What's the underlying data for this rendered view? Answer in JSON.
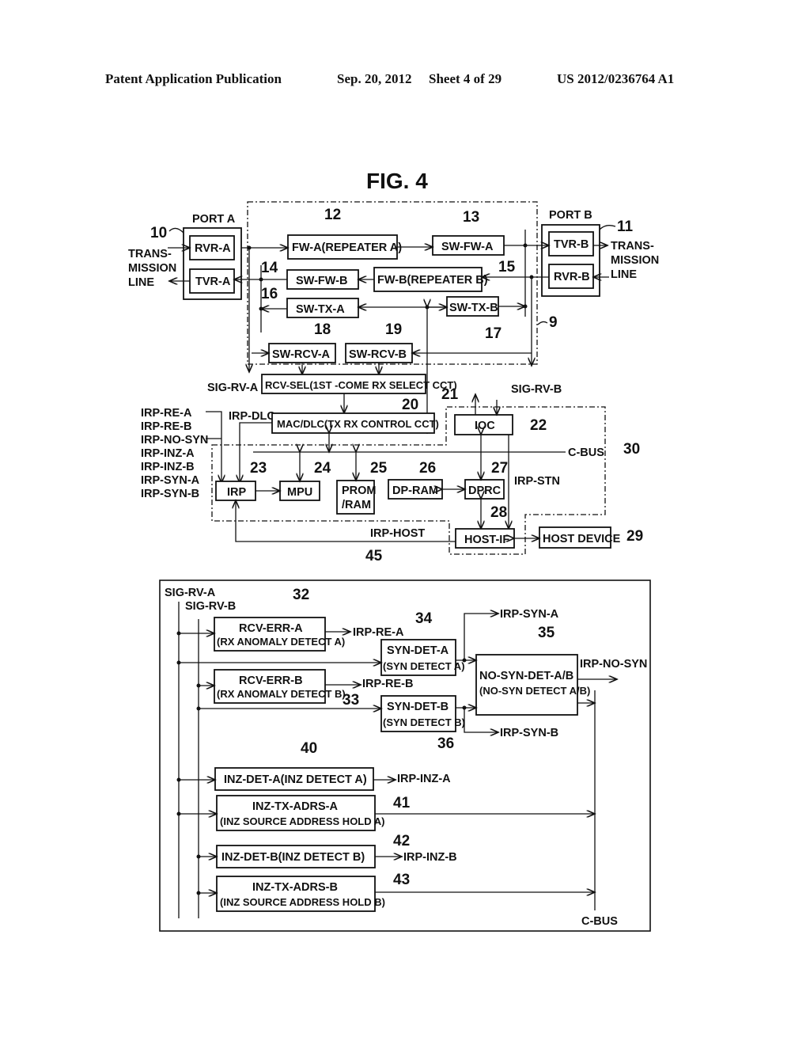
{
  "header": {
    "publication": "Patent Application Publication",
    "date": "Sep. 20, 2012",
    "sheet": "Sheet 4 of 29",
    "number": "US 2012/0236764 A1"
  },
  "figure": {
    "title": "FIG. 4",
    "port_a": {
      "label": "PORT A",
      "ref": "10",
      "rvr": "RVR-A",
      "tvr": "TVR-A"
    },
    "port_b": {
      "label": "PORT B",
      "ref": "11",
      "tvr": "TVR-B",
      "rvr": "RVR-B"
    },
    "line_left": [
      "TRANS-",
      "MISSION",
      "LINE"
    ],
    "line_right": [
      "TRANS-",
      "MISSION",
      "LINE"
    ],
    "blocks": {
      "fw_a": {
        "label": "FW-A(REPEATER A)",
        "ref": "12"
      },
      "sw_fw_a": {
        "label": "SW-FW-A",
        "ref": "13"
      },
      "sw_fw_b": {
        "label": "SW-FW-B",
        "ref": "14"
      },
      "fw_b": {
        "label": "FW-B(REPEATER B)",
        "ref": "15"
      },
      "sw_tx_a": {
        "label": "SW-TX-A",
        "ref": "16"
      },
      "sw_tx_b": {
        "label": "SW-TX-B",
        "ref": "17"
      },
      "sw_rcv_a": {
        "label": "SW-RCV-A",
        "ref": "18"
      },
      "sw_rcv_b": {
        "label": "SW-RCV-B",
        "ref": "19"
      },
      "rcv_sel": {
        "label": "RCV-SEL(1ST -COME RX SELECT CCT)",
        "ref": "20"
      },
      "mac_dlc": {
        "label": "MAC/DLC(TX RX CONTROL CCT)",
        "ref": "21"
      },
      "ioc": {
        "label": "IOC",
        "ref": "22"
      },
      "irp": {
        "label": "IRP",
        "ref": "23"
      },
      "mpu": {
        "label": "MPU",
        "ref": "24"
      },
      "prom_ram": {
        "label_1": "PROM",
        "label_2": "/RAM",
        "ref": "25"
      },
      "dp_ram": {
        "label": "DP-RAM",
        "ref": "26"
      },
      "dprc": {
        "label": "DPRC",
        "ref": "27"
      },
      "host_if": {
        "label": "HOST-IF",
        "ref": "28"
      },
      "host_device": {
        "label": "HOST DEVICE",
        "ref": "29"
      }
    },
    "refs": {
      "switch_unit": "9",
      "controller": "30",
      "monitor": "45"
    },
    "signals": {
      "sig_rv_a": "SIG-RV-A",
      "sig_rv_b": "SIG-RV-B",
      "irp_dlc": "IRP-DLC",
      "irp_stn": "IRP-STN",
      "irp_host": "IRP-HOST",
      "c_bus": "C-BUS",
      "irp_inputs": [
        "IRP-RE-A",
        "IRP-RE-B",
        "IRP-NO-SYN",
        "IRP-INZ-A",
        "IRP-INZ-B",
        "IRP-SYN-A",
        "IRP-SYN-B"
      ]
    },
    "monitor": {
      "sig_rv_a": "SIG-RV-A",
      "sig_rv_b": "SIG-RV-B",
      "rcv_err_a": {
        "l1": "RCV-ERR-A",
        "l2": "(RX ANOMALY DETECT A)",
        "ref": "32",
        "out": "IRP-RE-A"
      },
      "rcv_err_b": {
        "l1": "RCV-ERR-B",
        "l2": "(RX ANOMALY DETECT B)",
        "ref": "33",
        "out": "IRP-RE-B"
      },
      "syn_det_a": {
        "l1": "SYN-DET-A",
        "l2": "(SYN DETECT A)",
        "ref": "34",
        "out": "IRP-SYN-A"
      },
      "syn_det_b": {
        "l1": "SYN-DET-B",
        "l2": "(SYN DETECT B)",
        "ref": "36",
        "out": "IRP-SYN-B"
      },
      "no_syn": {
        "l1": "NO-SYN-DET-A/B",
        "l2": "(NO-SYN DETECT A/B)",
        "ref": "35",
        "out": "IRP-NO-SYN"
      },
      "inz_det_a": {
        "label": "INZ-DET-A(INZ DETECT A)",
        "ref": "40",
        "out": "IRP-INZ-A"
      },
      "inz_tx_a": {
        "l1": "INZ-TX-ADRS-A",
        "l2": "(INZ SOURCE ADDRESS HOLD A)",
        "ref": "41"
      },
      "inz_det_b": {
        "label": "INZ-DET-B(INZ DETECT B)",
        "ref": "42",
        "out": "IRP-INZ-B"
      },
      "inz_tx_b": {
        "l1": "INZ-TX-ADRS-B",
        "l2": "(INZ SOURCE ADDRESS HOLD B)",
        "ref": "43"
      },
      "c_bus": "C-BUS"
    }
  }
}
